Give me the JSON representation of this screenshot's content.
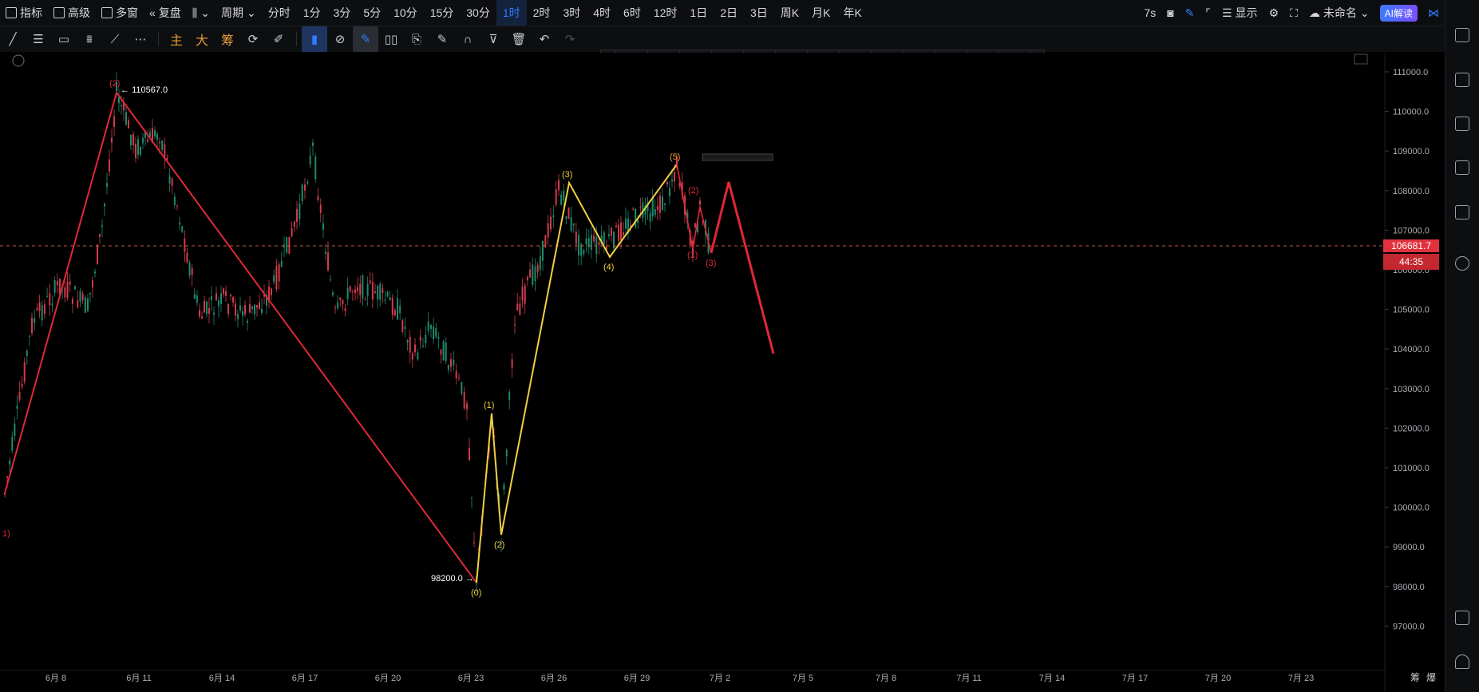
{
  "topbar": {
    "left_items": [
      {
        "label": "指标",
        "icon": "indicator-icon"
      },
      {
        "label": "高级",
        "icon": "advanced-icon"
      },
      {
        "label": "多窗",
        "icon": "multi-window-icon"
      },
      {
        "label": "复盘",
        "icon": "replay-icon"
      },
      {
        "label": "",
        "icon": "chart-type-icon"
      },
      {
        "label": "周期",
        "icon": "chevron-down-icon"
      }
    ],
    "periods": [
      "分时",
      "1分",
      "3分",
      "5分",
      "10分",
      "15分",
      "30分",
      "1时",
      "2时",
      "3时",
      "4时",
      "6时",
      "12时",
      "1日",
      "2日",
      "3日",
      "周K",
      "月K",
      "年K"
    ],
    "active_period": "1时",
    "right": {
      "countdown": "7s",
      "display_label": "显示",
      "layout_name": "未命名",
      "ai_label": "AI解读"
    }
  },
  "drawing_toolbar": {
    "chinese_tools": [
      "主",
      "大",
      "筹"
    ]
  },
  "chart_data": {
    "type": "candlestick",
    "price_axis_labels": [
      "111000.0",
      "110000.0",
      "109000.0",
      "108000.0",
      "107000.0",
      "106000.0",
      "105000.0",
      "104000.0",
      "103000.0",
      "102000.0",
      "101000.0",
      "100000.0",
      "99000.0",
      "98000.0",
      "97000.0"
    ],
    "time_axis_labels": [
      "6月 8",
      "6月 11",
      "6月 14",
      "6月 17",
      "6月 20",
      "6月 23",
      "6月 26",
      "6月 29",
      "7月 2",
      "7月 5",
      "7月 8",
      "7月 11",
      "7月 14",
      "7月 17",
      "7月 20",
      "7月 23"
    ],
    "current_price": "106681.7",
    "countdown": "44:35",
    "annotations": {
      "high_label": "110567.0",
      "low_label": "98200.0",
      "red_wave_labels": [
        "1)",
        "(2)"
      ],
      "yellow_wave_labels": [
        "(0)",
        "(1)",
        "(2)",
        "(3)",
        "(4)",
        "(5)"
      ],
      "minor_wave_labels": [
        "(1)",
        "(2)",
        "(3)"
      ]
    },
    "bottom_right": [
      "筹",
      "爆"
    ]
  },
  "colors": {
    "red_wave": "#e02838",
    "yellow_wave": "#f0d040",
    "up_candle": "#1f8a6e",
    "down_candle": "#d23b4c",
    "price_tag": "#e0313d",
    "accent": "#2f7bff"
  }
}
